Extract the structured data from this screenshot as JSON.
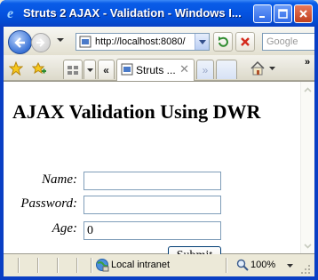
{
  "window": {
    "title": "Struts 2 AJAX - Validation - Windows I..."
  },
  "nav": {
    "url": "http://localhost:8080/",
    "search_placeholder": "Google"
  },
  "tabs": {
    "active_label": "Struts ...",
    "close_glyph": "✕"
  },
  "page": {
    "heading": "AJAX Validation Using DWR",
    "fields": [
      {
        "label": "Name:",
        "value": ""
      },
      {
        "label": "Password:",
        "value": ""
      },
      {
        "label": "Age:",
        "value": "0"
      }
    ],
    "submit_label": "Submit"
  },
  "status": {
    "zone": "Local intranet",
    "zoom": "100%"
  },
  "colors": {
    "titlebar": "#0553e0",
    "accent": "#3a73d6"
  }
}
